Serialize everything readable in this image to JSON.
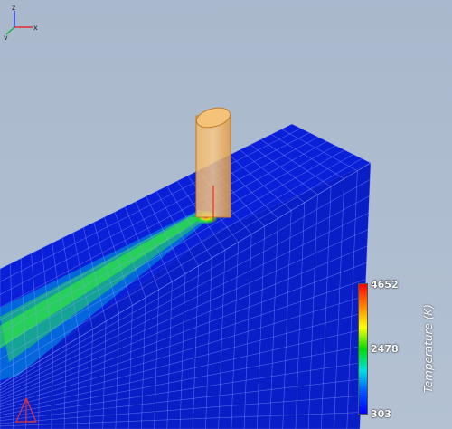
{
  "viewport": {
    "background": "#aab8cc"
  },
  "legend": {
    "title": "Temperature (K)",
    "max_label": "4652",
    "mid_label": "2478",
    "min_label": "303",
    "colors": [
      "#ff0000",
      "#ff8000",
      "#ffff00",
      "#00dd00",
      "#00e0e0",
      "#0055ff",
      "#0000ff"
    ]
  },
  "axis_triad": {
    "labels": [
      "x",
      "y",
      "z"
    ]
  },
  "scene": {
    "mesh_color": "#0a1fd8",
    "tool_color": "#f0a850"
  }
}
